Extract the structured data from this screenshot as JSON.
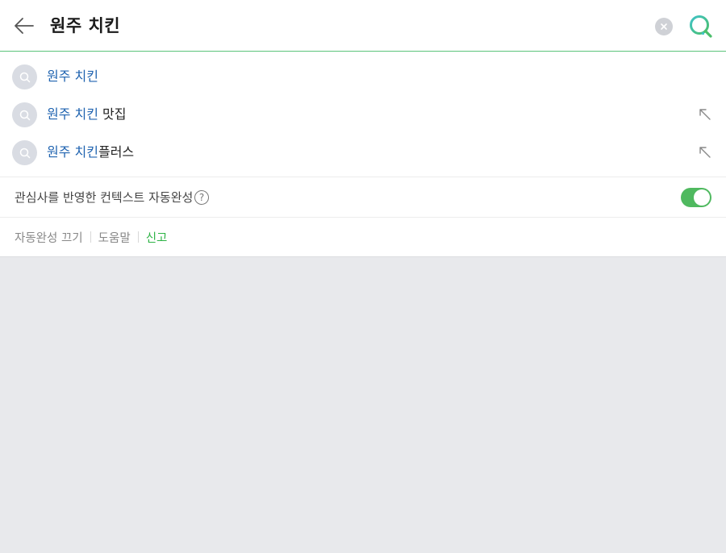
{
  "header": {
    "query": "원주 치킨",
    "icons": {
      "back": "back-arrow-icon",
      "clear": "clear-icon",
      "search": "search-icon"
    },
    "accent_color": "#5cc47a"
  },
  "suggestions": [
    {
      "highlight": "원주 치킨",
      "rest": "",
      "has_arrow": false
    },
    {
      "highlight": "원주 치킨",
      "rest": " 맛집",
      "has_arrow": true
    },
    {
      "highlight": "원주 치킨",
      "rest": "플러스",
      "has_arrow": true
    }
  ],
  "context": {
    "label": "관심사를 반영한 컨텍스트 자동완성",
    "help": "?",
    "toggle_on": true
  },
  "footer": {
    "autocomplete_off": "자동완성 끄기",
    "help": "도움말",
    "report": "신고"
  }
}
